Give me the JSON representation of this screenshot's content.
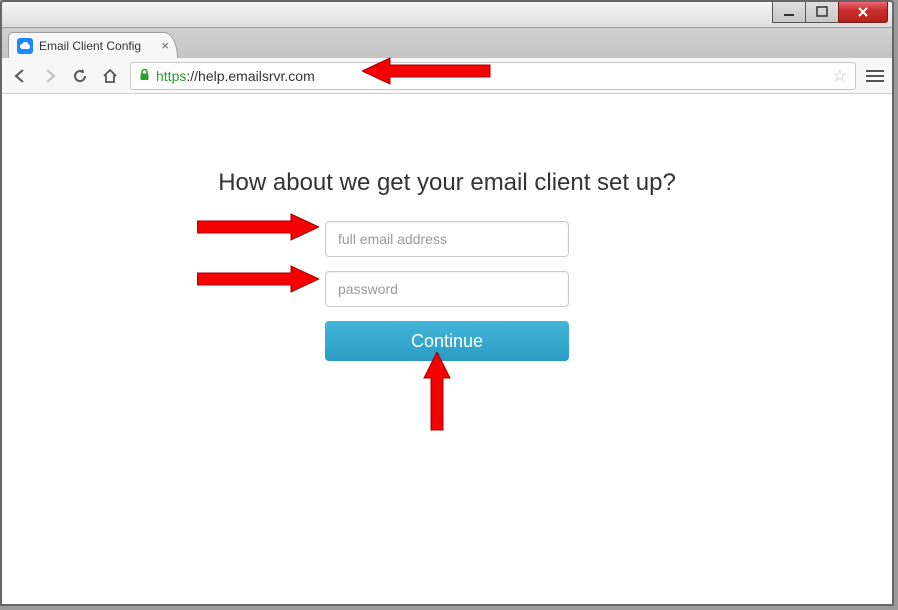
{
  "browser": {
    "tab_title": "Email Client Config",
    "url_scheme": "https",
    "url_display": "://help.emailsrvr.com"
  },
  "page": {
    "heading": "How about we get your email client set up?",
    "email_placeholder": "full email address",
    "password_placeholder": "password",
    "continue_label": "Continue"
  }
}
